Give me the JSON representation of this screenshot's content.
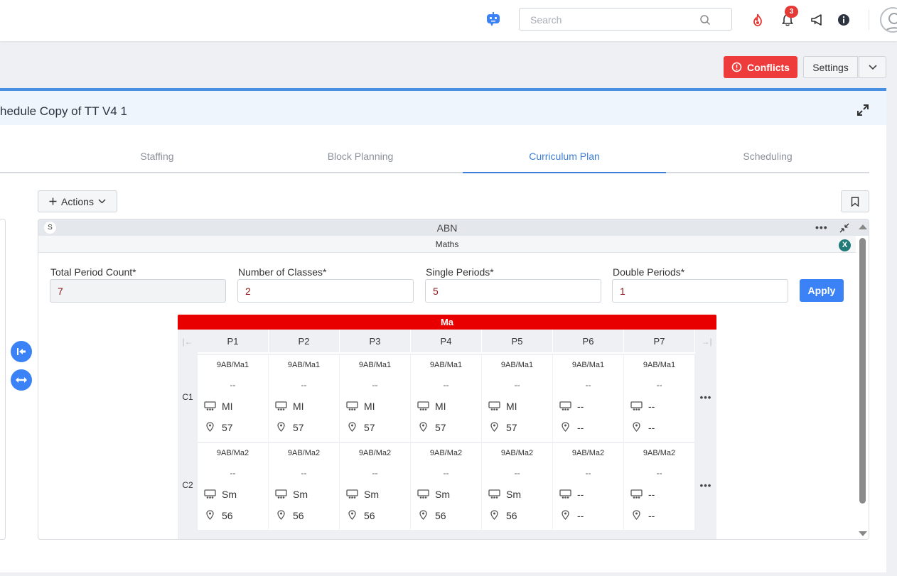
{
  "topbar": {
    "search_placeholder": "Search",
    "notification_count": "3",
    "icons": [
      "robot-icon",
      "search-icon",
      "fire-icon",
      "bell-icon",
      "megaphone-icon",
      "info-icon",
      "user-avatar-icon"
    ]
  },
  "toolbar": {
    "conflicts_label": "Conflicts",
    "settings_label": "Settings"
  },
  "panel": {
    "title": "hedule Copy of TT V4 1",
    "tabs": [
      {
        "label": "Staffing",
        "active": false
      },
      {
        "label": "Block Planning",
        "active": false
      },
      {
        "label": "Curriculum Plan",
        "active": true
      },
      {
        "label": "Scheduling",
        "active": false
      }
    ],
    "actions_label": "Actions"
  },
  "card": {
    "badge": "S",
    "code": "ABN",
    "subject": "Maths",
    "close_badge": "X",
    "fields": {
      "total_period_label": "Total Period Count*",
      "total_period_value": "7",
      "classes_label": "Number of Classes*",
      "classes_value": "2",
      "single_label": "Single Periods*",
      "single_value": "5",
      "double_label": "Double Periods*",
      "double_value": "1"
    },
    "apply_label": "Apply"
  },
  "grid": {
    "subject_code": "Ma",
    "periods": [
      "P1",
      "P2",
      "P3",
      "P4",
      "P5",
      "P6",
      "P7"
    ],
    "rows": [
      {
        "label": "C1",
        "cells": [
          {
            "code": "9AB/Ma1",
            "dash": "--",
            "teacher": "MI",
            "room": "57"
          },
          {
            "code": "9AB/Ma1",
            "dash": "--",
            "teacher": "MI",
            "room": "57"
          },
          {
            "code": "9AB/Ma1",
            "dash": "--",
            "teacher": "MI",
            "room": "57"
          },
          {
            "code": "9AB/Ma1",
            "dash": "--",
            "teacher": "MI",
            "room": "57"
          },
          {
            "code": "9AB/Ma1",
            "dash": "--",
            "teacher": "MI",
            "room": "57"
          },
          {
            "code": "9AB/Ma1",
            "dash": "--",
            "teacher": "--",
            "room": "--"
          },
          {
            "code": "9AB/Ma1",
            "dash": "--",
            "teacher": "--",
            "room": "--"
          }
        ]
      },
      {
        "label": "C2",
        "cells": [
          {
            "code": "9AB/Ma2",
            "dash": "--",
            "teacher": "Sm",
            "room": "56"
          },
          {
            "code": "9AB/Ma2",
            "dash": "--",
            "teacher": "Sm",
            "room": "56"
          },
          {
            "code": "9AB/Ma2",
            "dash": "--",
            "teacher": "Sm",
            "room": "56"
          },
          {
            "code": "9AB/Ma2",
            "dash": "--",
            "teacher": "Sm",
            "room": "56"
          },
          {
            "code": "9AB/Ma2",
            "dash": "--",
            "teacher": "Sm",
            "room": "56"
          },
          {
            "code": "9AB/Ma2",
            "dash": "--",
            "teacher": "--",
            "room": "--"
          },
          {
            "code": "9AB/Ma2",
            "dash": "--",
            "teacher": "--",
            "room": "--"
          }
        ]
      }
    ]
  },
  "colors": {
    "accent": "#3b82f6",
    "danger": "#ee3b3b",
    "subject_header": "#e80000",
    "active_tab": "#3b7dd8"
  }
}
